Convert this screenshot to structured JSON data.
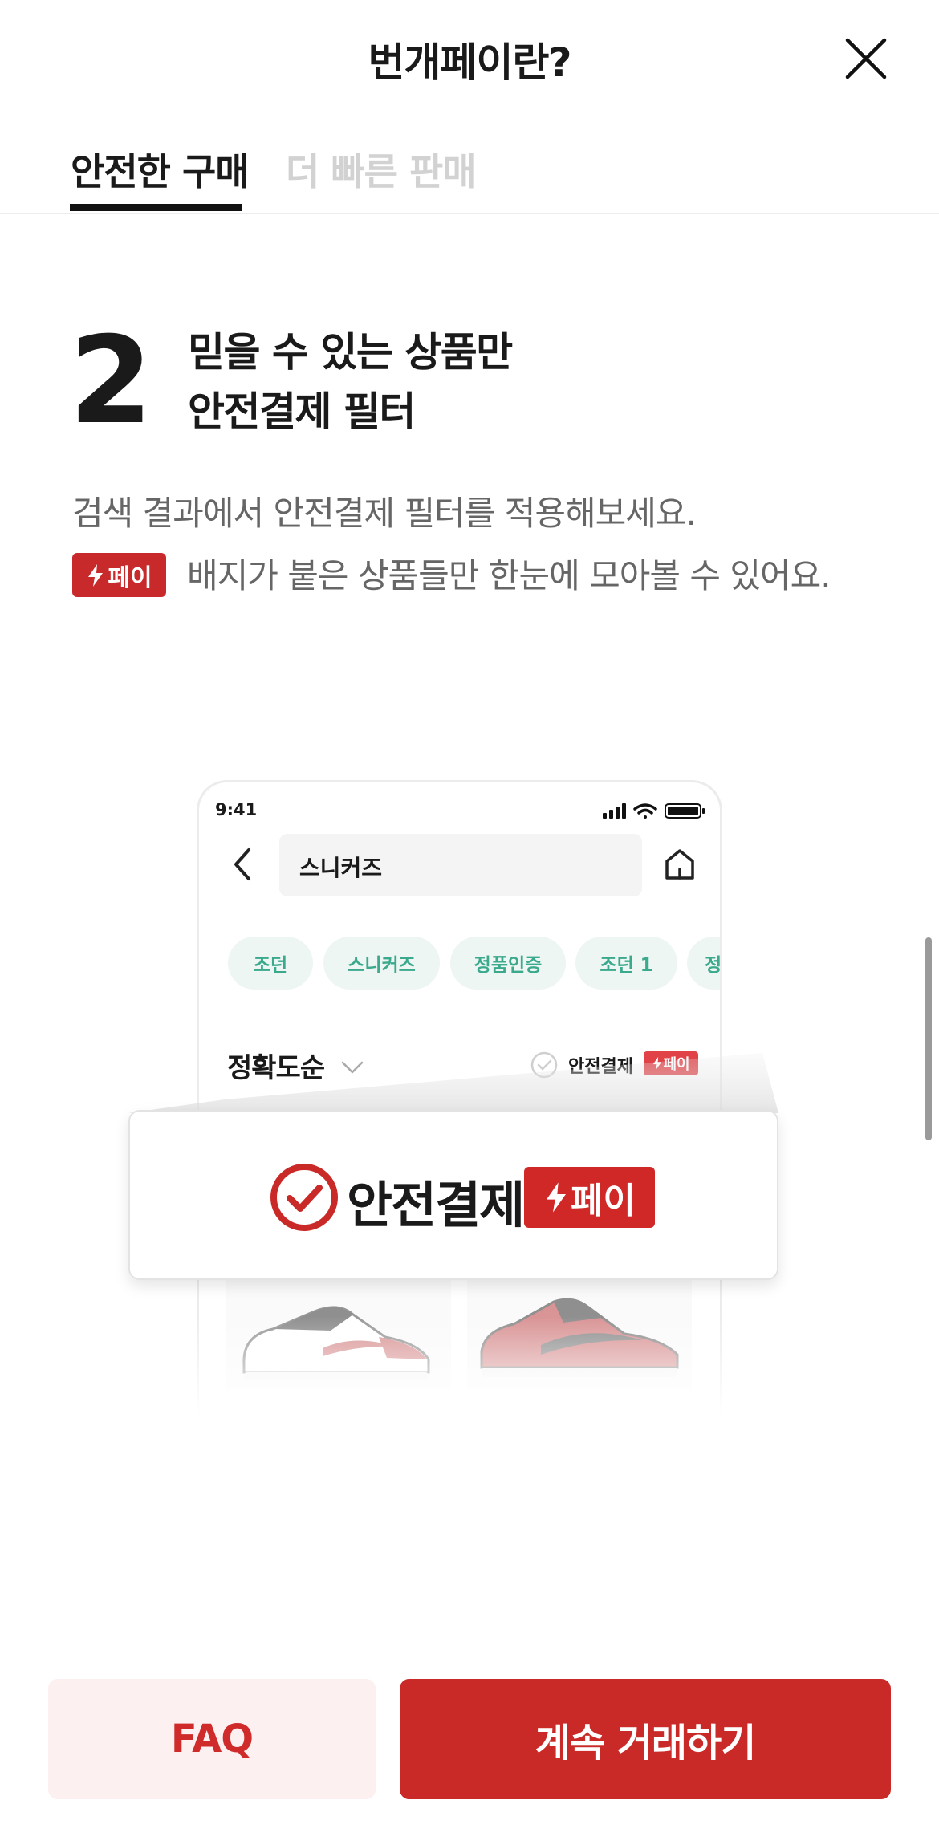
{
  "header": {
    "title": "번개페이란?"
  },
  "tabs": [
    {
      "label": "안전한 구매"
    },
    {
      "label": "더 빠른 판매"
    }
  ],
  "step": {
    "number": "2",
    "title_line1": "믿을 수 있는 상품만",
    "title_line2": "안전결제 필터"
  },
  "description": {
    "line1": "검색 결과에서 안전결제 필터를 적용해보세요.",
    "badge": "페이",
    "line2": "배지가 붙은 상품들만 한눈에 모아볼 수 있어요."
  },
  "mock_phone": {
    "time": "9:41",
    "search_text": "스니커즈",
    "chips": [
      "조던",
      "스니커즈",
      "정품인증",
      "조던 1",
      "정"
    ],
    "sort_label": "정확도순",
    "filter_label": "안전결제",
    "filter_badge": "페이"
  },
  "highlight": {
    "label": "안전결제",
    "badge": "페이"
  },
  "buttons": {
    "faq": "FAQ",
    "continue": "계속 거래하기"
  },
  "colors": {
    "accent": "#c92a28",
    "faq_bg": "#fcf0f0",
    "chip_bg": "#eef6f3",
    "chip_text": "#3ba98c"
  }
}
